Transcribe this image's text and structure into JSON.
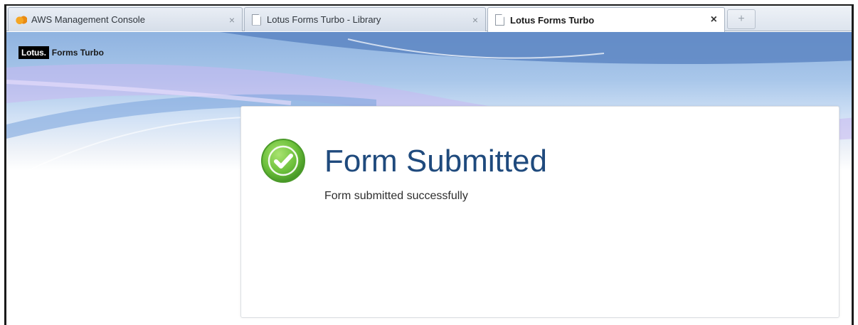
{
  "browser": {
    "tabs": [
      {
        "title": "AWS Management Console",
        "favicon": "aws-icon",
        "active": false
      },
      {
        "title": "Lotus Forms Turbo - Library",
        "favicon": "page-icon",
        "active": false
      },
      {
        "title": "Lotus Forms Turbo",
        "favicon": "page-icon",
        "active": true
      }
    ],
    "close_glyph": "×",
    "new_tab_glyph": "+"
  },
  "header": {
    "brand_mark": "Lotus.",
    "product": "Forms Turbo"
  },
  "card": {
    "icon": "check-circle-icon",
    "title": "Form Submitted",
    "message": "Form submitted successfully"
  },
  "colors": {
    "title": "#1f4a7d",
    "success": "#6bbf3a"
  }
}
